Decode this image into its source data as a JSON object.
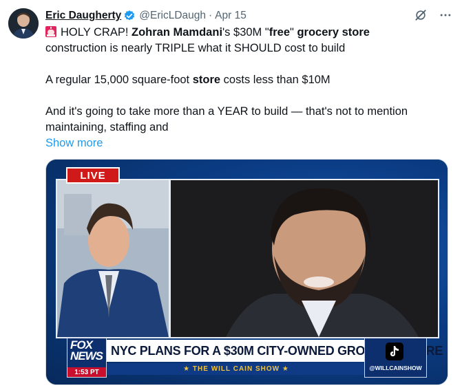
{
  "tweet": {
    "author_name": "Eric Daugherty",
    "handle": "@EricLDaugh",
    "separator": "·",
    "date": "Apr 15",
    "line1_pre": "HOLY CRAP! ",
    "line1_b1": "Zohran Mamdani",
    "line1_mid1": "'s $30M \"",
    "line1_b2": "free",
    "line1_mid2": "\" ",
    "line1_b3": "grocery store",
    "line2": "construction is nearly TRIPLE what it SHOULD cost to build",
    "p2_pre": "A regular 15,000 square-foot ",
    "p2_b": "store",
    "p2_post": " costs less than $10M",
    "p3_line1": "And it's going to take more than a YEAR to build — that's not to mention",
    "p3_line2": "maintaining, staffing and",
    "show_more": "Show more"
  },
  "media": {
    "live_label": "LIVE",
    "fox_logo": "FOX NEWS",
    "time": "1:53 PT",
    "headline": "NYC PLANS FOR A $30M CITY-OWNED GROCERY STORE",
    "show_name": "★ THE WILL CAIN SHOW ★",
    "tiktok_handle": "@WILLCAINSHOW"
  },
  "icons": {
    "verified": "verified-badge-icon",
    "grok": "grok-icon",
    "more": "more-icon",
    "alarm": "rotating-light-icon"
  },
  "colors": {
    "link": "#1d9bf0",
    "secondary_text": "#536471",
    "verified": "#1d9bf0",
    "live_red": "#d01a1a"
  }
}
